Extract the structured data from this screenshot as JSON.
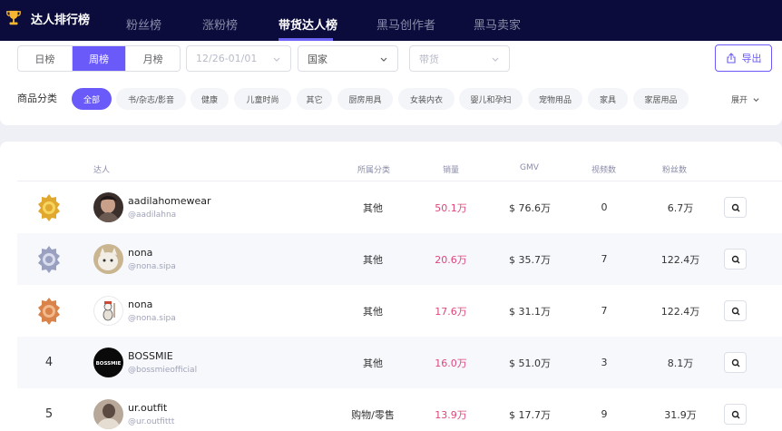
{
  "header": {
    "brand_title": "达人排行榜",
    "tabs": [
      {
        "label": "粉丝榜"
      },
      {
        "label": "涨粉榜"
      },
      {
        "label": "带货达人榜"
      },
      {
        "label": "黑马创作者"
      },
      {
        "label": "黑马卖家"
      }
    ],
    "active_tab": "带货达人榜"
  },
  "filters": {
    "period": [
      {
        "label": "日榜"
      },
      {
        "label": "周榜"
      },
      {
        "label": "月榜"
      }
    ],
    "active_period": "周榜",
    "date_range": "12/26-01/01",
    "country": "国家",
    "type": "带货",
    "export_label": "导出"
  },
  "categories": {
    "label": "商品分类",
    "items": [
      {
        "label": "全部"
      },
      {
        "label": "书/杂志/影音"
      },
      {
        "label": "健康"
      },
      {
        "label": "儿童时尚"
      },
      {
        "label": "其它"
      },
      {
        "label": "厨房用具"
      },
      {
        "label": "女装内衣"
      },
      {
        "label": "婴儿和孕妇"
      },
      {
        "label": "宠物用品"
      },
      {
        "label": "家具"
      },
      {
        "label": "家居用品"
      }
    ],
    "expand_label": "展开"
  },
  "table": {
    "columns": {
      "influencer": "达人",
      "category": "所属分类",
      "sales": "销量",
      "gmv": "GMV",
      "videos": "视频数",
      "followers": "粉丝数"
    },
    "rows": [
      {
        "rank": "1",
        "medal": "gold",
        "name": "aadilahomewear",
        "handle": "@aadilahna",
        "category": "其他",
        "sales": "50.1万",
        "gmv": "$ 76.6万",
        "videos": "0",
        "followers": "6.7万"
      },
      {
        "rank": "2",
        "medal": "silver",
        "name": "nona",
        "handle": "@nona.sipa",
        "category": "其他",
        "sales": "20.6万",
        "gmv": "$ 35.7万",
        "videos": "7",
        "followers": "122.4万"
      },
      {
        "rank": "3",
        "medal": "bronze",
        "name": "nona",
        "handle": "@nona.sipa",
        "category": "其他",
        "sales": "17.6万",
        "gmv": "$ 31.1万",
        "videos": "7",
        "followers": "122.4万"
      },
      {
        "rank": "4",
        "medal": "",
        "name": "BOSSMIE",
        "handle": "@bossmieofficial",
        "category": "其他",
        "sales": "16.0万",
        "gmv": "$ 51.0万",
        "videos": "3",
        "followers": "8.1万"
      },
      {
        "rank": "5",
        "medal": "",
        "name": "ur.outfit",
        "handle": "@ur.outfittt",
        "category": "购物/零售",
        "sales": "13.9万",
        "gmv": "$ 17.7万",
        "videos": "9",
        "followers": "31.9万"
      }
    ],
    "avatar_3_logo_text": "BOSSMIE"
  },
  "colors": {
    "topbar": "#0c0c3c",
    "accent": "#6a5af9",
    "sales": "#e0457b",
    "gold": "#e0a82e",
    "silver": "#9aa0c0",
    "bronze": "#d9824a"
  },
  "icons": {
    "brand": "trophy-icon",
    "export": "export-icon",
    "dropdown": "chevron-down-icon",
    "row_action": "search-icon",
    "medals": [
      "gold-medal-icon",
      "silver-medal-icon",
      "bronze-medal-icon"
    ]
  }
}
